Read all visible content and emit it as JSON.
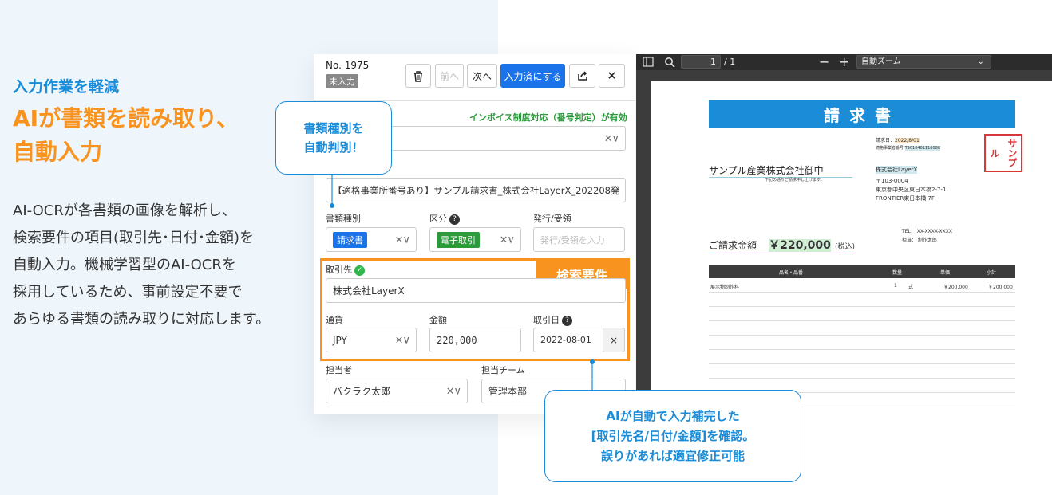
{
  "left": {
    "kicker": "入力作業を軽減",
    "headline_line1": "AIが書類を読み取り、",
    "headline_line2": "自動入力",
    "body_lines": [
      "AI-OCRが各書類の画像を解析し、",
      "検索要件の項目(取引先･日付･金額)を",
      "自動入力。機械学習型のAI-OCRを",
      "採用しているため、事前設定不要で",
      "あらゆる書類の読み取りに対応します。"
    ]
  },
  "form": {
    "doc_no": "No. 1975",
    "status": "未入力",
    "toolbar": {
      "prev": "前へ",
      "next": "次へ",
      "mark_done": "入力済にする",
      "close": "×"
    },
    "invoice_note": "インボイス制度対応（番号判定）が有効",
    "filename": "【適格事業所番号あり】サンプル請求書_株式会社LayerX_202208発",
    "doc_type_label": "書類種別",
    "doc_type_value": "請求書",
    "category_label": "区分",
    "category_value": "電子取引",
    "issue_label": "発行/受領",
    "issue_placeholder": "発行/受領を入力",
    "partner_label": "取引先",
    "partner_value": "株式会社LayerX",
    "search_req_label": "検索要件",
    "currency_label": "通貨",
    "currency_value": "JPY",
    "amount_label": "金額",
    "amount_value": "220,000",
    "date_label": "取引日",
    "date_value": "2022-08-01",
    "owner_label": "担当者",
    "owner_value": "バクラク太郎",
    "team_label": "担当チーム",
    "team_value": "管理本部",
    "clear_symbol": "×",
    "select_symbol": "×∨"
  },
  "callouts": {
    "top_line1": "書類種別を",
    "top_line2": "自動判別！",
    "bottom_line1": "AIが自動で入力補完した",
    "bottom_line2": "[取引先名/日付/金額]を確認。",
    "bottom_line3": "誤りがあれば適宜修正可能"
  },
  "viewer": {
    "page_current": "1",
    "page_total": "/ 1",
    "zoom": "自動ズーム",
    "minus": "−",
    "plus": "+"
  },
  "invoice": {
    "title": "請求書",
    "date_label": "請求日：",
    "date_value": "2022/8/01",
    "reg_label": "適格事業者番号",
    "reg_value": "T9010401116088",
    "client": "サンプル産業株式会社御中",
    "client_sub": "下記の通りご請求申し上げます。",
    "issuer": "株式会社LayerX",
    "postal": "〒103-0004",
    "address1": "東京都中央区東日本橋2-7-1",
    "address2": "FRONTIER東日本橋 7F",
    "tel": "TEL： XX-XXXX-XXXX",
    "person": "担当： 制作太郎",
    "amount_label": "ご請求金額",
    "amount_value": "￥220,000",
    "tax": "(税込)",
    "seal": "サンプル",
    "columns": [
      "品名・品番",
      "数量",
      "単価",
      "小計"
    ],
    "item": {
      "name": "展示物制作料",
      "qty": "1",
      "unit": "式",
      "price": "￥200,000",
      "subtotal": "￥200,000"
    }
  },
  "colors": {
    "accent_blue": "#1a8cd8",
    "accent_orange": "#f7931e",
    "primary_button": "#1a73e8",
    "tag_blue": "#1a73e8",
    "tag_green": "#2a9a3a"
  }
}
